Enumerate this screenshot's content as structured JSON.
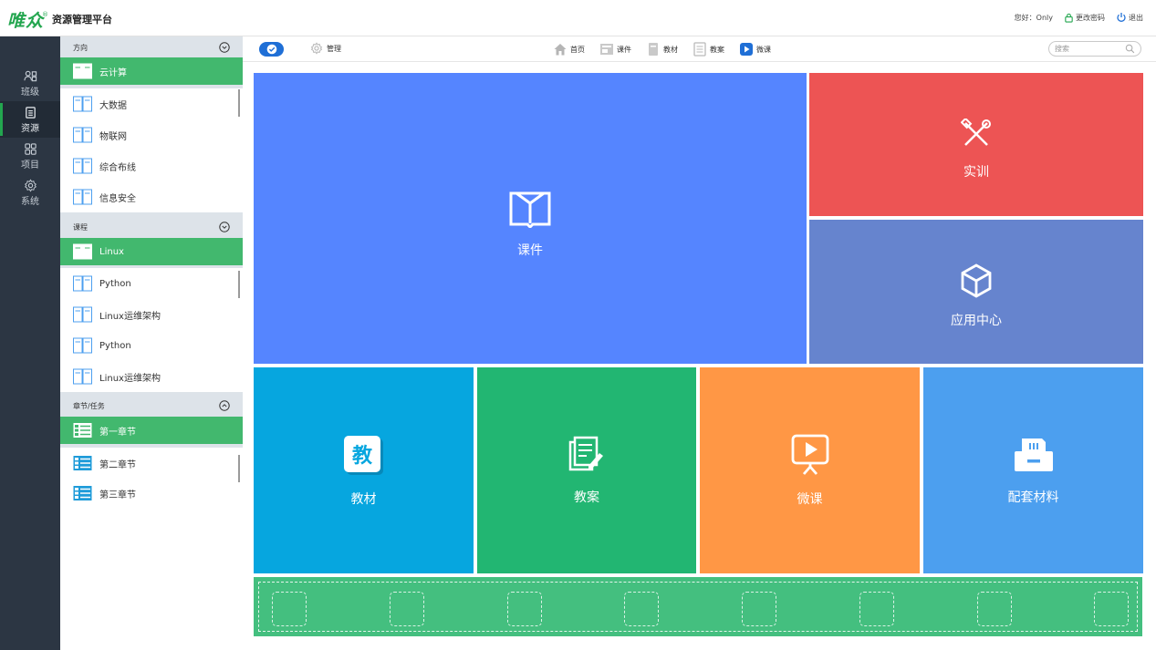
{
  "brand": {
    "mark": "唯众",
    "reg": "®",
    "name": "资源管理平台"
  },
  "user": {
    "greeting": "您好：Only",
    "change_password": "更改密码",
    "logout": "退出"
  },
  "leftnav": [
    {
      "label": "班级",
      "icon": "users-icon"
    },
    {
      "label": "资源",
      "icon": "document-icon"
    },
    {
      "label": "项目",
      "icon": "grid-icon"
    },
    {
      "label": "系统",
      "icon": "settings-icon"
    }
  ],
  "sidebar": {
    "direction": {
      "title": "方向",
      "items": [
        "云计算",
        "大数据",
        "物联网",
        "综合布线",
        "信息安全"
      ]
    },
    "course": {
      "title": "课程",
      "items": [
        "Linux",
        "Python",
        "Linux运维架构",
        "Python",
        "Linux运维架构"
      ]
    },
    "chapter": {
      "title": "章节/任务",
      "items": [
        "第一章节",
        "第二章节",
        "第三章节"
      ]
    }
  },
  "toolbar": {
    "manage": "管理",
    "nav": [
      {
        "label": "首页",
        "icon": "home-icon"
      },
      {
        "label": "课件",
        "icon": "courseware-icon"
      },
      {
        "label": "教材",
        "icon": "textbook-icon"
      },
      {
        "label": "教案",
        "icon": "lesson-plan-icon"
      },
      {
        "label": "微课",
        "icon": "microlesson-icon"
      }
    ],
    "search_placeholder": "搜索"
  },
  "tiles": {
    "courseware": "课件",
    "training": "实训",
    "app_center": "应用中心",
    "textbook": "教材",
    "lesson_plan": "教案",
    "microlesson": "微课",
    "materials": "配套材料"
  },
  "colors": {
    "brand": "#23a64f",
    "courseware": "#5585ff",
    "training": "#ed5454",
    "app_center": "#6684ce",
    "textbook": "#06a6df",
    "lesson_plan": "#22b672",
    "microlesson": "#ff9745",
    "materials": "#4c9fef",
    "strip": "#44bf7f"
  }
}
